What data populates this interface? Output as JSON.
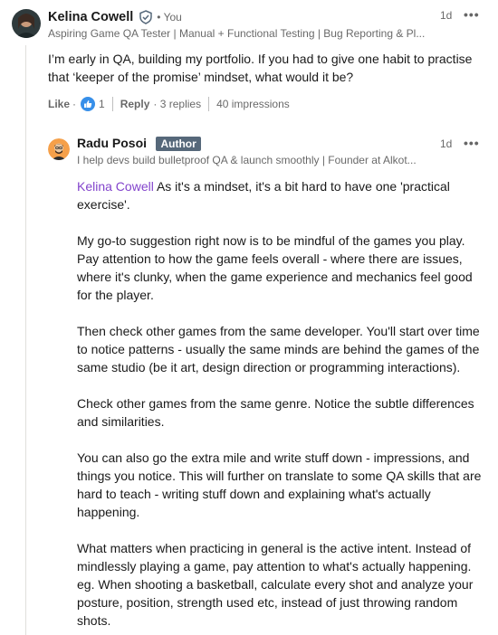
{
  "comment": {
    "author_name": "Kelina Cowell",
    "you_label": "• You",
    "headline": "Aspiring Game QA Tester | Manual + Functional Testing | Bug Reporting & Pl...",
    "time": "1d",
    "text": "I’m early in QA, building my portfolio. If you had to give one habit to practise that ‘keeper of the promise’ mindset, what would it be?",
    "actions": {
      "like_label": "Like",
      "dot": "·",
      "reaction_count": "1",
      "reply_label": "Reply",
      "replies": "· 3 replies",
      "impressions": "40 impressions"
    }
  },
  "reply": {
    "author_name": "Radu Posoi",
    "badge": "Author",
    "headline": "I help devs build bulletproof QA & launch smoothly | Founder at Alkot...",
    "time": "1d",
    "mention": "Kelina Cowell",
    "first_paragraph_rest": " As it's a mindset, it's a bit hard to have one 'practical exercise'.",
    "paragraphs": [
      "My go-to suggestion right now is to be mindful of the games you play. Pay attention to how the game feels overall - where there are issues, where it's clunky, when the game experience and mechanics feel good for the player.",
      "Then check other games from the same developer. You'll start over time to notice patterns - usually the same minds are behind the games of the same studio (be it art, design direction or programming interactions).",
      "Check other games from the same genre. Notice the subtle differences and similarities.",
      "You can also go the extra mile and write stuff down - impressions, and things you notice. This will further on translate to some QA skills that are hard to teach - writing stuff down and explaining what's actually happening.",
      "What matters when practicing in general is the active intent. Instead of mindlessly playing a game, pay attention to what's actually happening. eg. When shooting a basketball, calculate every shot and analyze your posture, position, strength used etc, instead of just throwing random shots."
    ]
  },
  "icons": {
    "more": "more-options-icon",
    "verified": "verified-shield-icon",
    "like_reaction": "like-reaction-icon"
  },
  "colors": {
    "mention": "#8344cc",
    "author_badge": "#56687a",
    "like_blue": "#378fe9"
  }
}
